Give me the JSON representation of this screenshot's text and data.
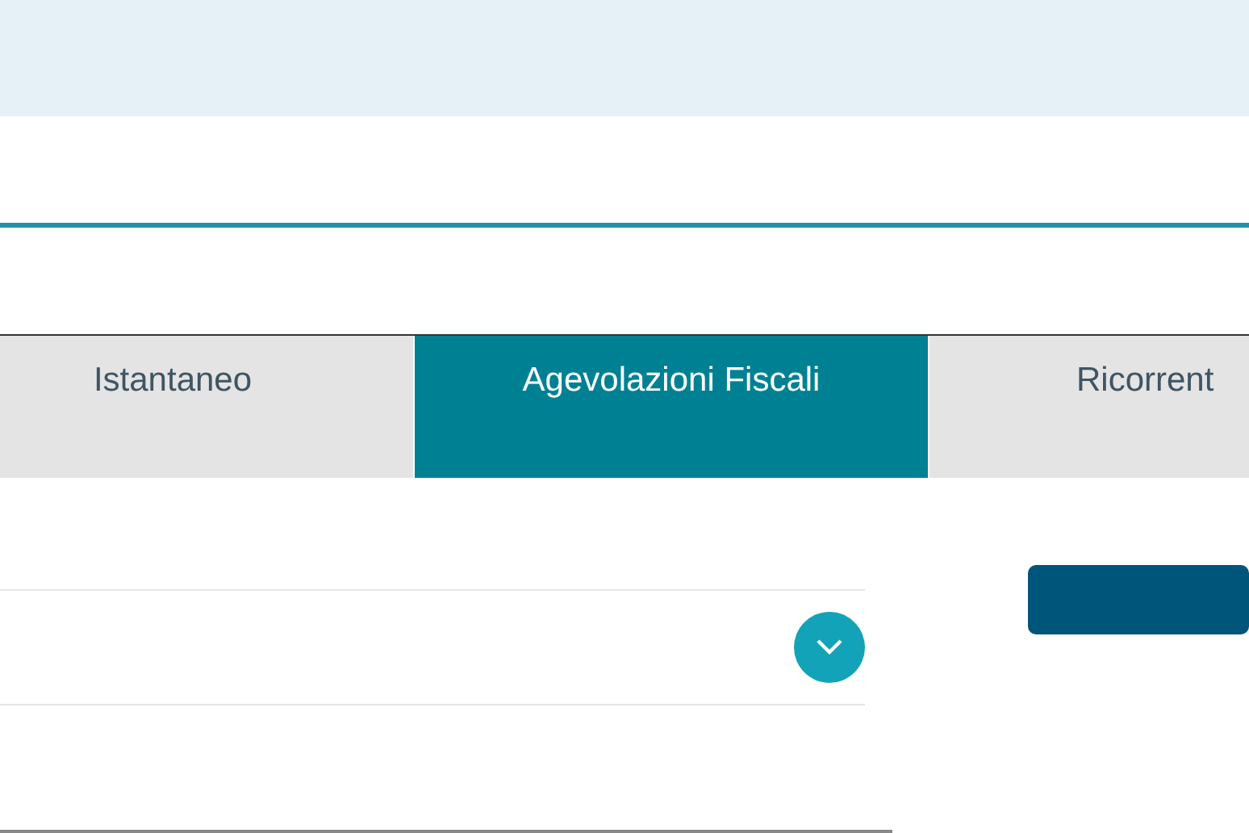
{
  "tabs": [
    {
      "label": "Istantaneo",
      "selected": false
    },
    {
      "label": "Agevolazioni Fiscali",
      "selected": true
    },
    {
      "label": "Ricorrent",
      "selected": false
    }
  ],
  "dropdown": {
    "expanded": false
  }
}
